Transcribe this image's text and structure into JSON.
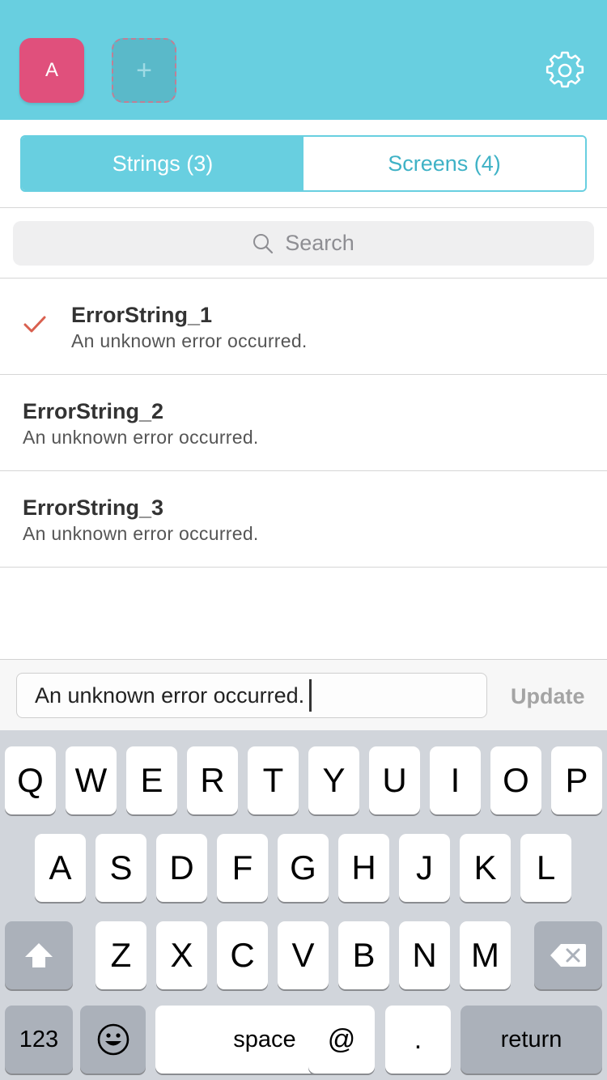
{
  "header": {
    "avatar_letter": "A",
    "add_label": "+"
  },
  "tabs": [
    {
      "label": "Strings (3)",
      "active": true
    },
    {
      "label": "Screens (4)",
      "active": false
    }
  ],
  "search": {
    "placeholder": "Search"
  },
  "strings": [
    {
      "name": "ErrorString_1",
      "value": "An unknown error occurred.",
      "selected": true
    },
    {
      "name": "ErrorString_2",
      "value": "An unknown error occurred.",
      "selected": false
    },
    {
      "name": "ErrorString_3",
      "value": "An unknown error occurred.",
      "selected": false
    }
  ],
  "editor": {
    "value": "An unknown error occurred.",
    "update_label": "Update"
  },
  "keyboard": {
    "row1": [
      "Q",
      "W",
      "E",
      "R",
      "T",
      "Y",
      "U",
      "I",
      "O",
      "P"
    ],
    "row2": [
      "A",
      "S",
      "D",
      "F",
      "G",
      "H",
      "J",
      "K",
      "L"
    ],
    "row3": [
      "Z",
      "X",
      "C",
      "V",
      "B",
      "N",
      "M"
    ],
    "numbers_label": "123",
    "space_label": "space",
    "at_label": "@",
    "dot_label": ".",
    "return_label": "return"
  },
  "colors": {
    "accent": "#68cfe0",
    "avatar": "#e0507c",
    "checkmark": "#d9604f"
  },
  "icons": {
    "settings": "gear-icon",
    "search": "search-icon",
    "selected": "checkmark-icon",
    "shift": "shift-icon",
    "delete": "backspace-icon",
    "emoji": "emoji-icon"
  }
}
